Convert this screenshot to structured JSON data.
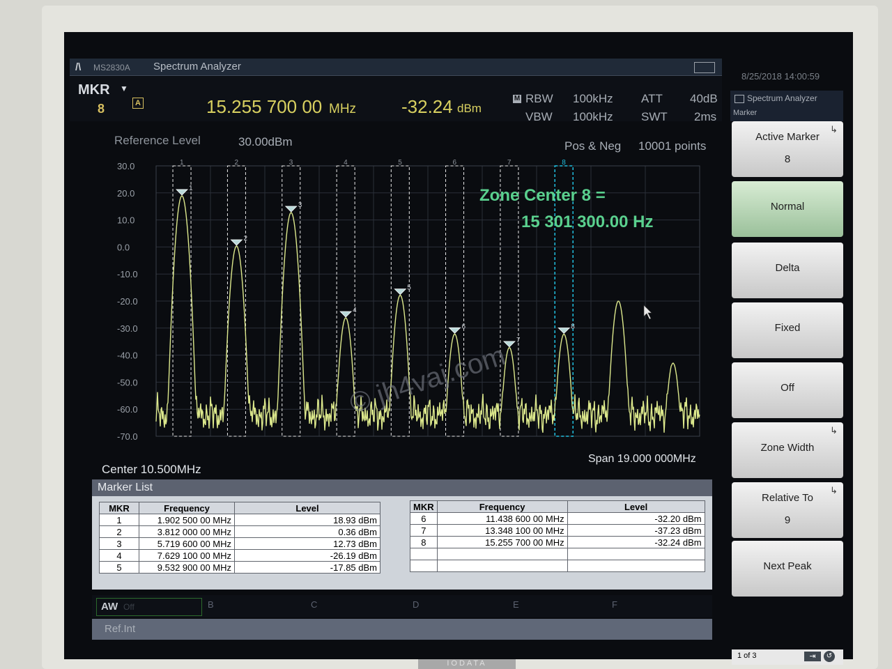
{
  "window": {
    "model": "MS2830A",
    "app_title": "Spectrum Analyzer",
    "datetime": "8/25/2018 14:00:59"
  },
  "readout": {
    "mkr_label": "MKR",
    "mkr_number": "8",
    "trace_badge": "A",
    "marker_freq": "15.255 700 00",
    "marker_freq_unit": "MHz",
    "marker_level": "-32.24",
    "marker_level_unit": "dBm",
    "m_badge": "M",
    "rbw_label": "RBW",
    "rbw_value": "100kHz",
    "vbw_label": "VBW",
    "vbw_value": "100kHz",
    "att_label": "ATT",
    "att_value": "40dB",
    "swt_label": "SWT",
    "swt_value": "2ms"
  },
  "refbar": {
    "reference_level_label": "Reference Level",
    "reference_level_value": "30.00dBm",
    "detection": "Pos & Neg",
    "points": "10001 points"
  },
  "plot": {
    "center": "Center 10.500MHz",
    "span": "Span 19.000 000MHz",
    "annotation_line1": "Zone Center 8 =",
    "annotation_line2": "15 301 300.00 Hz",
    "watermark": "© jh4vaj.com",
    "trace_color": "#dce88c",
    "zone_color": "#e8e8e8",
    "active_zone_color": "#20c0e0"
  },
  "chart_data": {
    "type": "line",
    "title": "",
    "xlabel": "",
    "ylabel": "",
    "yticks": [
      "30.0",
      "20.0",
      "10.0",
      "0.0",
      "-10.0",
      "-20.0",
      "-30.0",
      "-40.0",
      "-50.0",
      "-60.0",
      "-70.0"
    ],
    "ylim": [
      -70,
      30
    ],
    "xlim": [
      1,
      20
    ],
    "noise_floor": -62,
    "peaks": [
      {
        "marker": "1",
        "freq_mhz": 1.9025,
        "level_dbm": 18.93
      },
      {
        "marker": "2",
        "freq_mhz": 3.812,
        "level_dbm": 0.36
      },
      {
        "marker": "3",
        "freq_mhz": 5.7196,
        "level_dbm": 12.73
      },
      {
        "marker": "4",
        "freq_mhz": 7.6291,
        "level_dbm": -26.19
      },
      {
        "marker": "5",
        "freq_mhz": 9.5329,
        "level_dbm": -17.85
      },
      {
        "marker": "6",
        "freq_mhz": 11.4386,
        "level_dbm": -32.2
      },
      {
        "marker": "7",
        "freq_mhz": 13.3481,
        "level_dbm": -37.23
      },
      {
        "marker": "8",
        "freq_mhz": 15.2557,
        "level_dbm": -32.24
      },
      {
        "marker": "",
        "freq_mhz": 17.16,
        "level_dbm": -20
      },
      {
        "marker": "",
        "freq_mhz": 19.07,
        "level_dbm": -43
      }
    ],
    "zones": [
      "1",
      "2",
      "3",
      "4",
      "5",
      "6",
      "7",
      "8"
    ],
    "active_zone": "8"
  },
  "marker_list": {
    "title": "Marker List",
    "headers": {
      "mkr": "MKR",
      "frequency": "Frequency",
      "level": "Level"
    },
    "left_rows": [
      {
        "mkr": "1",
        "frequency": "1.902 500 00 MHz",
        "level": "18.93 dBm"
      },
      {
        "mkr": "2",
        "frequency": "3.812 000 00 MHz",
        "level": "0.36 dBm"
      },
      {
        "mkr": "3",
        "frequency": "5.719 600 00 MHz",
        "level": "12.73 dBm"
      },
      {
        "mkr": "4",
        "frequency": "7.629 100 00 MHz",
        "level": "-26.19 dBm"
      },
      {
        "mkr": "5",
        "frequency": "9.532 900 00 MHz",
        "level": "-17.85 dBm"
      }
    ],
    "right_rows": [
      {
        "mkr": "6",
        "frequency": "11.438 600 00 MHz",
        "level": "-32.20 dBm"
      },
      {
        "mkr": "7",
        "frequency": "13.348 100 00 MHz",
        "level": "-37.23 dBm"
      },
      {
        "mkr": "8",
        "frequency": "15.255 700 00 MHz",
        "level": "-32.24 dBm"
      },
      {
        "mkr": "",
        "frequency": "",
        "level": ""
      },
      {
        "mkr": "",
        "frequency": "",
        "level": ""
      }
    ]
  },
  "function_bar": {
    "aw": "AW",
    "aw_state": "Off",
    "keys": [
      "B",
      "C",
      "D",
      "E",
      "F"
    ],
    "status": "Ref.Int"
  },
  "softkeys": {
    "header": "Spectrum Analyzer",
    "subheader": "Marker",
    "items": [
      {
        "line1": "Active Marker",
        "line2": "8",
        "submenu": true
      },
      {
        "line1": "Normal",
        "line2": "",
        "active": true
      },
      {
        "line1": "Delta",
        "line2": ""
      },
      {
        "line1": "Fixed",
        "line2": ""
      },
      {
        "line1": "Off",
        "line2": ""
      },
      {
        "line1": "Zone Width",
        "line2": "",
        "submenu": true
      },
      {
        "line1": "Relative To",
        "line2": "9",
        "submenu": true
      },
      {
        "line1": "Next Peak",
        "line2": ""
      }
    ],
    "page": "1 of 3"
  },
  "monitor_brand": "IODATA"
}
